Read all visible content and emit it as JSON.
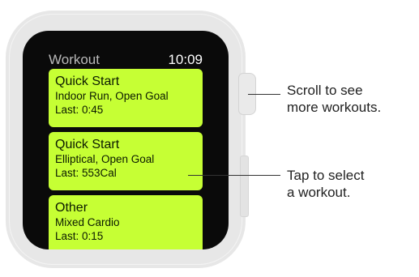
{
  "watch": {
    "app_title": "Workout",
    "time": "10:09",
    "workouts": [
      {
        "title": "Quick Start",
        "detail": "Indoor Run, Open Goal",
        "last": "Last: 0:45"
      },
      {
        "title": "Quick Start",
        "detail": "Elliptical, Open Goal",
        "last": "Last: 553Cal"
      },
      {
        "title": "Other",
        "detail": "Mixed Cardio",
        "last": "Last: 0:15"
      }
    ],
    "card_color": "#c6ff34"
  },
  "annotations": {
    "scroll_line1": "Scroll to see",
    "scroll_line2": "more workouts.",
    "tap_line1": "Tap to select",
    "tap_line2": "a workout."
  }
}
